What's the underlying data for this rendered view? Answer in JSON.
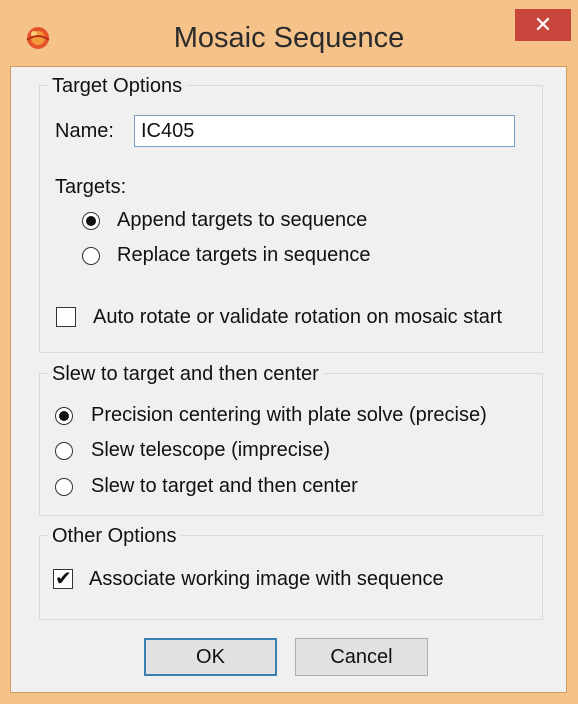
{
  "window": {
    "title": "Mosaic Sequence",
    "close_glyph": "✕",
    "accent": "#f5c38a",
    "close_color": "#c7453a"
  },
  "target_options": {
    "legend": "Target Options",
    "name_label": "Name:",
    "name_value": "IC405",
    "targets_label": "Targets:",
    "radios": [
      {
        "label": "Append targets to sequence",
        "selected": true
      },
      {
        "label": "Replace targets in sequence",
        "selected": false
      }
    ],
    "auto_rotate": {
      "label": "Auto rotate or validate rotation on mosaic start",
      "checked": false
    }
  },
  "slew": {
    "legend": "Slew to target and then center",
    "radios": [
      {
        "label": "Precision centering with plate solve (precise)",
        "selected": true
      },
      {
        "label": "Slew telescope (imprecise)",
        "selected": false
      },
      {
        "label": "Slew to target and then center",
        "selected": false
      }
    ]
  },
  "other_options": {
    "legend": "Other Options",
    "associate": {
      "label": "Associate working image with sequence",
      "checked": true
    }
  },
  "buttons": {
    "ok": "OK",
    "cancel": "Cancel"
  }
}
